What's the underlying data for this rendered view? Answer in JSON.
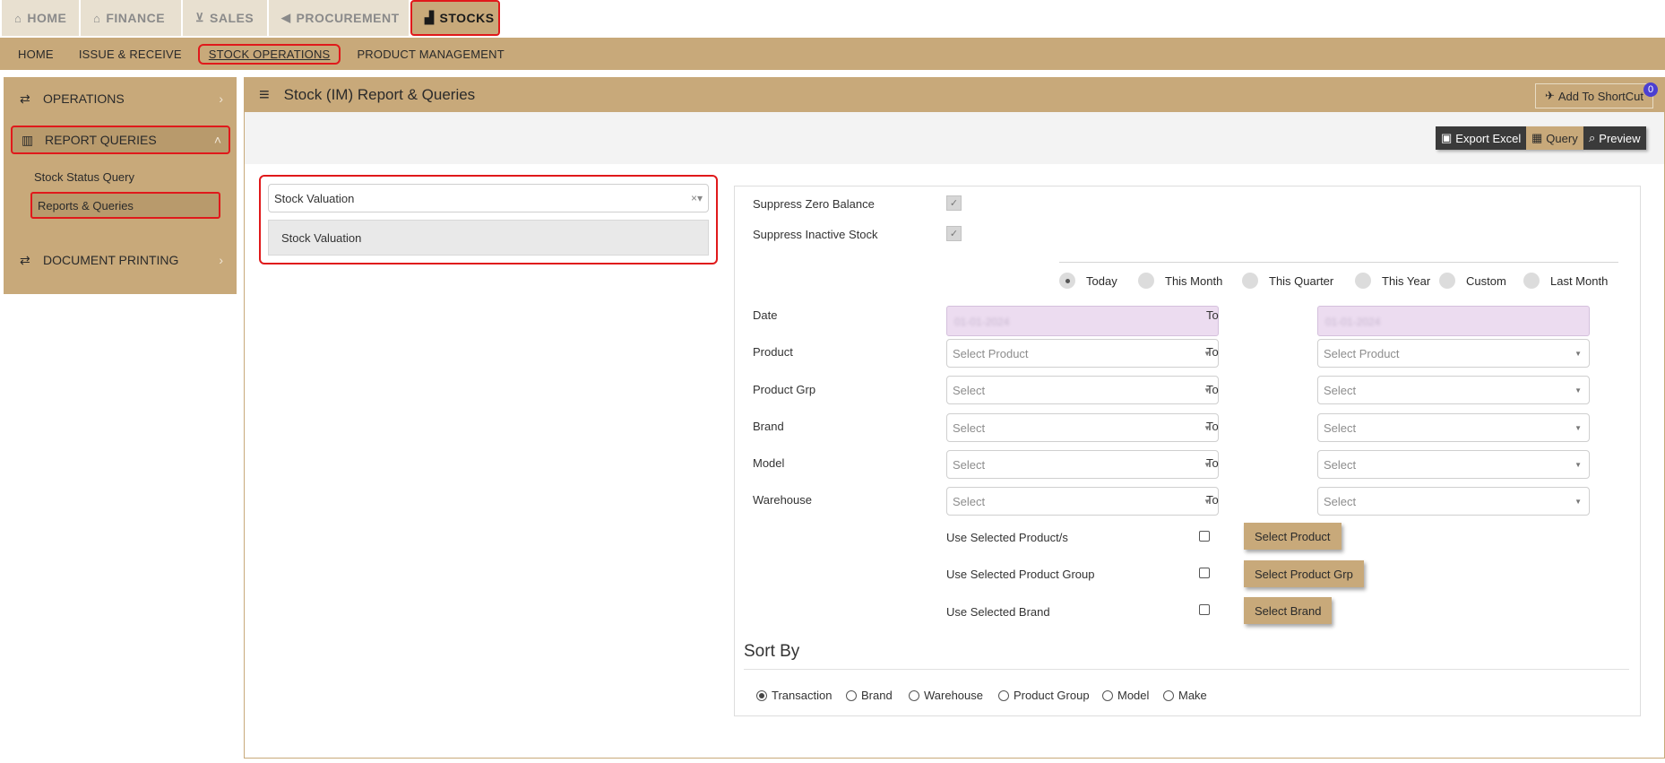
{
  "top_tabs": [
    {
      "label": "HOME",
      "icon": "home-icon",
      "glyph": "⌂"
    },
    {
      "label": "FINANCE",
      "icon": "bank-icon",
      "glyph": "🏛"
    },
    {
      "label": "SALES",
      "icon": "cart-icon",
      "glyph": "🛒"
    },
    {
      "label": "PROCUREMENT",
      "icon": "megaphone-icon",
      "glyph": "📢"
    },
    {
      "label": "STOCKS",
      "icon": "factory-icon",
      "glyph": "🏭"
    }
  ],
  "subnav": [
    "HOME",
    "ISSUE & RECEIVE",
    "STOCK OPERATIONS",
    "PRODUCT MANAGEMENT"
  ],
  "sidebar": {
    "operations": "OPERATIONS",
    "report_queries": "REPORT QUERIES",
    "stock_status_query": "Stock Status Query",
    "reports_queries": "Reports & Queries",
    "document_printing": "DOCUMENT PRINTING"
  },
  "panel": {
    "title": "Stock (IM) Report & Queries",
    "shortcut": "Add To ShortCut",
    "shortcut_count": "0"
  },
  "toolbar": {
    "export_excel": "Export Excel",
    "query": "Query",
    "preview": "Preview"
  },
  "report": {
    "selected": "Stock Valuation",
    "option": "Stock Valuation"
  },
  "form": {
    "suppress_zero": "Suppress Zero Balance",
    "suppress_inactive": "Suppress Inactive Stock",
    "periods": [
      "Today",
      "This Month",
      "This Quarter",
      "This Year",
      "Custom",
      "Last Month"
    ],
    "selected_period": "Today",
    "to": "To",
    "date_label": "Date",
    "date_from": "01-01-2024",
    "date_to": "01-01-2024",
    "product_label": "Product",
    "product_placeholder": "Select Product",
    "product_grp_label": "Product Grp",
    "brand_label": "Brand",
    "model_label": "Model",
    "warehouse_label": "Warehouse",
    "select_placeholder": "Select",
    "use_products": "Use Selected Product/s",
    "use_group": "Use Selected Product Group",
    "use_brand": "Use Selected Brand",
    "btn_product": "Select Product",
    "btn_group": "Select Product Grp",
    "btn_brand": "Select Brand"
  },
  "sort": {
    "title": "Sort By",
    "options": [
      "Transaction",
      "Brand",
      "Warehouse",
      "Product Group",
      "Model",
      "Make"
    ],
    "selected": "Transaction"
  },
  "colors": {
    "brand_gold": "#c8a97a",
    "highlight_red": "#e0191b",
    "date_field": "#ecdcf0",
    "badge": "#4b3fd1"
  }
}
